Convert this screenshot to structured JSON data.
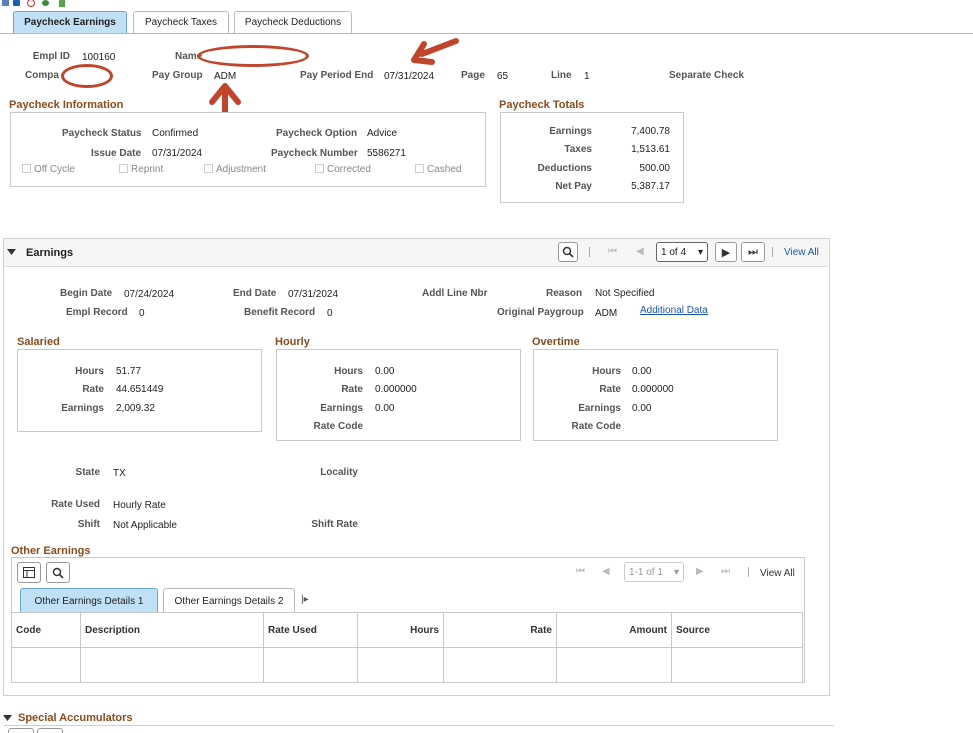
{
  "tabs": [
    {
      "label": "Paycheck Earnings",
      "active": true
    },
    {
      "label": "Paycheck Taxes"
    },
    {
      "label": "Paycheck Deductions"
    }
  ],
  "header": {
    "empl_id_label": "Empl ID",
    "empl_id": "100160",
    "name_label": "Name",
    "company_label": "Compa",
    "pay_group_label": "Pay Group",
    "pay_group": "ADM",
    "pay_period_end_label": "Pay Period End",
    "pay_period_end": "07/31/2024",
    "page_label": "Page",
    "page": "65",
    "line_label": "Line",
    "line": "1",
    "separate_check_label": "Separate Check"
  },
  "paycheck_info": {
    "title": "Paycheck Information",
    "status_label": "Paycheck Status",
    "status": "Confirmed",
    "option_label": "Paycheck Option",
    "option": "Advice",
    "issue_date_label": "Issue Date",
    "issue_date": "07/31/2024",
    "number_label": "Paycheck Number",
    "number": "5586271",
    "checks": [
      "Off Cycle",
      "Reprint",
      "Adjustment",
      "Corrected",
      "Cashed"
    ]
  },
  "totals": {
    "title": "Paycheck Totals",
    "rows": [
      {
        "label": "Earnings",
        "value": "7,400.78"
      },
      {
        "label": "Taxes",
        "value": "1,513.61"
      },
      {
        "label": "Deductions",
        "value": "500.00"
      },
      {
        "label": "Net Pay",
        "value": "5,387.17"
      }
    ]
  },
  "earnings": {
    "title": "Earnings",
    "pager": "1 of 4",
    "view_all": "View All",
    "begin_date_label": "Begin Date",
    "begin_date": "07/24/2024",
    "end_date_label": "End Date",
    "end_date": "07/31/2024",
    "addl_line_label": "Addl Line Nbr",
    "reason_label": "Reason",
    "reason": "Not Specified",
    "empl_record_label": "Empl Record",
    "empl_record": "0",
    "benefit_record_label": "Benefit Record",
    "benefit_record": "0",
    "orig_paygroup_label": "Original Paygroup",
    "orig_paygroup": "ADM",
    "additional_data": "Additional Data",
    "salaried": {
      "title": "Salaried",
      "hours_label": "Hours",
      "hours": "51.77",
      "rate_label": "Rate",
      "rate": "44.651449",
      "earnings_label": "Earnings",
      "earnings": "2,009.32"
    },
    "hourly": {
      "title": "Hourly",
      "hours_label": "Hours",
      "hours": "0.00",
      "rate_label": "Rate",
      "rate": "0.000000",
      "earnings_label": "Earnings",
      "earnings": "0.00",
      "rate_code_label": "Rate Code"
    },
    "overtime": {
      "title": "Overtime",
      "hours_label": "Hours",
      "hours": "0.00",
      "rate_label": "Rate",
      "rate": "0.000000",
      "earnings_label": "Earnings",
      "earnings": "0.00",
      "rate_code_label": "Rate Code"
    },
    "state_label": "State",
    "state": "TX",
    "locality_label": "Locality",
    "rate_used_label": "Rate Used",
    "rate_used": "Hourly Rate",
    "shift_label": "Shift",
    "shift": "Not Applicable",
    "shift_rate_label": "Shift Rate"
  },
  "other_earnings": {
    "title": "Other Earnings",
    "pager": "1-1 of 1",
    "view_all": "View All",
    "subtabs": [
      {
        "label": "Other Earnings Details 1",
        "active": true
      },
      {
        "label": "Other Earnings Details 2"
      }
    ],
    "columns": [
      "Code",
      "Description",
      "Rate Used",
      "Hours",
      "Rate",
      "Amount",
      "Source"
    ]
  },
  "special_accumulators": {
    "title": "Special Accumulators"
  },
  "colors": {
    "accent": "#8a4b1d",
    "tab_active": "#bfe0f5",
    "annotation": "#c0452c",
    "link": "#1a56a8"
  }
}
